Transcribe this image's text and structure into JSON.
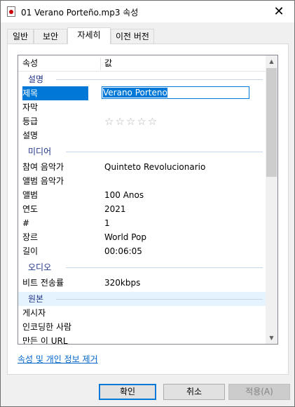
{
  "window": {
    "title": "01 Verano Porteño.mp3 속성",
    "close_glyph": "✕"
  },
  "tabs": [
    {
      "label": "일반",
      "active": false
    },
    {
      "label": "보안",
      "active": false
    },
    {
      "label": "자세히",
      "active": true
    },
    {
      "label": "이전 버전",
      "active": false
    }
  ],
  "columns": {
    "property": "속성",
    "value": "값"
  },
  "groups": {
    "description": "설명",
    "media": "미디어",
    "audio": "오디오",
    "origin": "원본"
  },
  "properties": {
    "title": {
      "label": "제목",
      "value": "Verano Porteno"
    },
    "subtitle": {
      "label": "자막",
      "value": ""
    },
    "rating": {
      "label": "등급",
      "stars": "☆☆☆☆☆",
      "rating_value": 0,
      "rating_max": 5
    },
    "comments": {
      "label": "설명",
      "value": ""
    },
    "contributing_artists": {
      "label": "참여 음악가",
      "value": "Quinteto Revolucionario"
    },
    "album_artist": {
      "label": "앨범 음악가",
      "value": ""
    },
    "album": {
      "label": "앨범",
      "value": "100 Anos"
    },
    "year": {
      "label": "연도",
      "value": "2021"
    },
    "track": {
      "label": "#",
      "value": "1"
    },
    "genre": {
      "label": "장르",
      "value": "World Pop"
    },
    "length": {
      "label": "길이",
      "value": "00:06:05"
    },
    "bitrate": {
      "label": "비트 전송률",
      "value": "320kbps"
    },
    "publisher": {
      "label": "게시자",
      "value": ""
    },
    "encoded_by": {
      "label": "인코딩한 사람",
      "value": ""
    },
    "author_url": {
      "label": "만든 이 URL",
      "value": ""
    }
  },
  "link_text": "속성 및 개인 정보 제거",
  "buttons": {
    "ok": "확인",
    "cancel": "취소",
    "apply": "적용(A)"
  },
  "colors": {
    "selection": "#0078d7",
    "group_text": "#1e3287",
    "link": "#0066cc"
  }
}
